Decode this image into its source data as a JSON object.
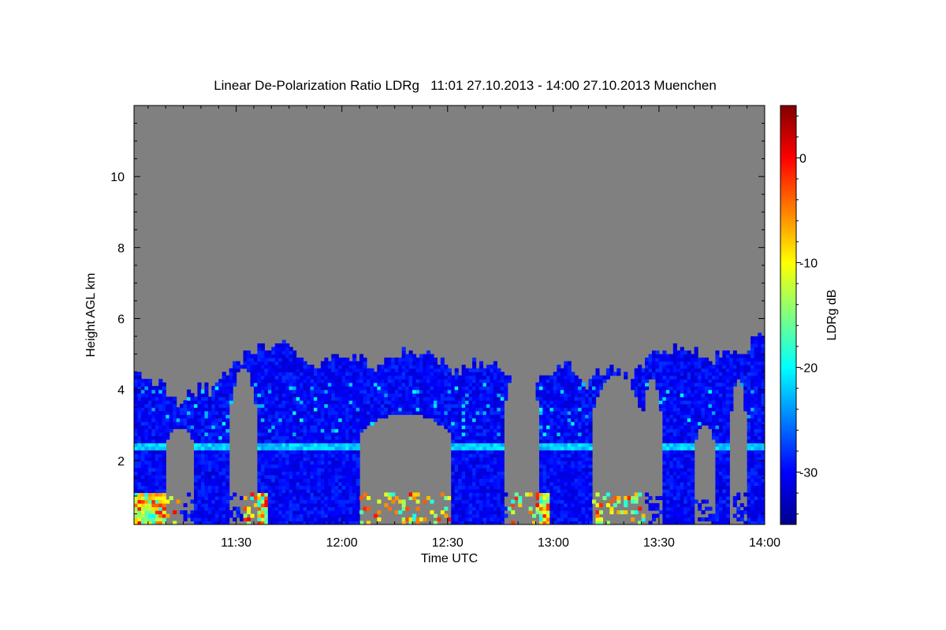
{
  "chart_data": {
    "type": "heatmap",
    "title": "Linear De-Polarization Ratio LDRg   11:01 27.10.2013 - 14:00 27.10.2013 Muenchen",
    "xlabel": "Time UTC",
    "ylabel": "Height AGL km",
    "colorbar_label": "LDRg dB",
    "x_range": [
      "11:01",
      "14:00"
    ],
    "y_range": [
      0.2,
      12.0
    ],
    "x_ticks": [
      "11:30",
      "12:00",
      "12:30",
      "13:00",
      "13:30",
      "14:00"
    ],
    "y_ticks": [
      "2",
      "4",
      "6",
      "8",
      "10"
    ],
    "colorbar_range": [
      -35,
      5
    ],
    "colorbar_ticks": [
      "0",
      "-10",
      "-20",
      "-30"
    ],
    "colormap": "jet",
    "missing_color": "#808080",
    "features": {
      "melting_layer_km": 2.35,
      "cloud_top_km": [
        4.3,
        5.3
      ],
      "background_dB": -30,
      "melting_layer_dB": -22,
      "near_surface_dB": [
        -20,
        0
      ]
    }
  }
}
